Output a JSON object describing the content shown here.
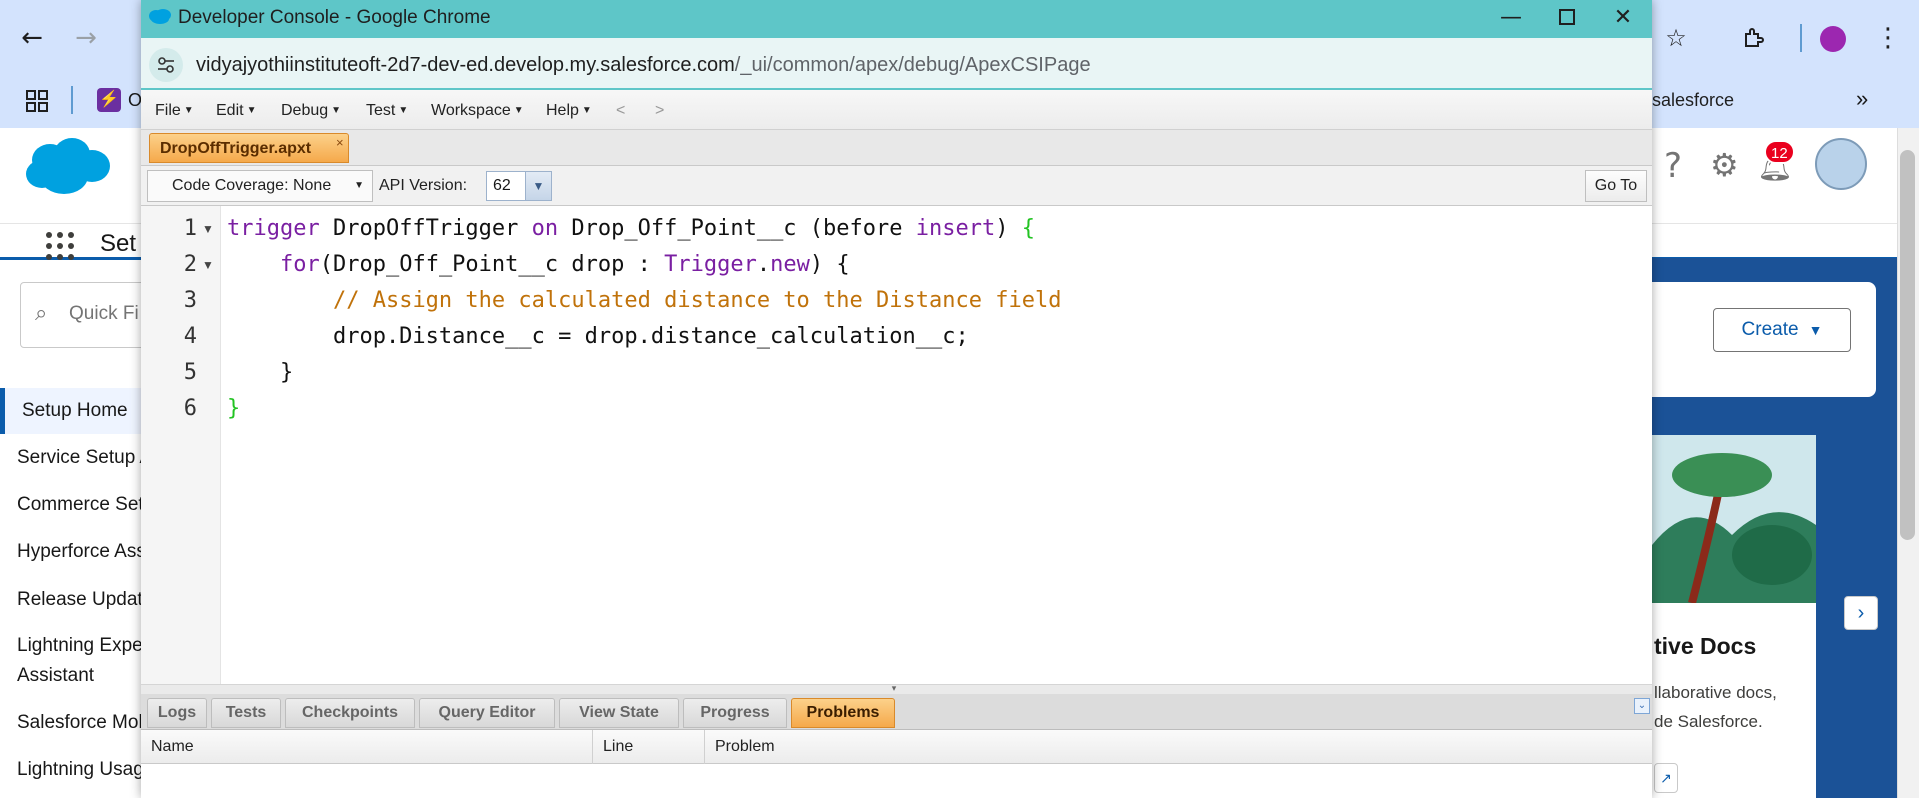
{
  "background": {
    "bookmark_text": "salesforce",
    "bookmark_partial": "O",
    "notification_count": "12",
    "create_label": "Create",
    "setup_partial": "Set",
    "quick_find_placeholder": "Quick Fi",
    "sidebar_items": [
      "Setup Home",
      "Service Setup A",
      "Commerce Set",
      "Hyperforce Ass",
      "Release Updat",
      "Lightning Expe",
      "Assistant",
      "Salesforce Mol",
      "Lightning Usag"
    ],
    "doc_title": "tive Docs",
    "doc_line1": "llaborative docs,",
    "doc_line2": "de Salesforce."
  },
  "window": {
    "title": "Developer Console - Google Chrome",
    "url_host": "vidyajyothiinstituteoft-2d7-dev-ed.develop.my.salesforce.com",
    "url_path": "/_ui/common/apex/debug/ApexCSIPage"
  },
  "menu": {
    "items": [
      "File",
      "Edit",
      "Debug",
      "Test",
      "Workspace",
      "Help"
    ],
    "back": "<",
    "forward": ">"
  },
  "file_tab": {
    "name": "DropOffTrigger.apxt",
    "close": "×"
  },
  "toolbar": {
    "coverage": "Code Coverage: None",
    "api_label": "API Version:",
    "api_value": "62",
    "goto": "Go To"
  },
  "code": {
    "line_numbers": [
      "1",
      "2",
      "3",
      "4",
      "5",
      "6"
    ]
  },
  "bottom_tabs": [
    "Logs",
    "Tests",
    "Checkpoints",
    "Query Editor",
    "View State",
    "Progress",
    "Problems"
  ],
  "problems_columns": [
    "Name",
    "Line",
    "Problem"
  ],
  "colors": {
    "titlebar": "#5ec6c8",
    "active_tab": "#f5a94b",
    "keyword": "#7a1fa2",
    "comment": "#c0720a",
    "brace": "#22c322",
    "salesforce_blue": "#0b5cab"
  }
}
